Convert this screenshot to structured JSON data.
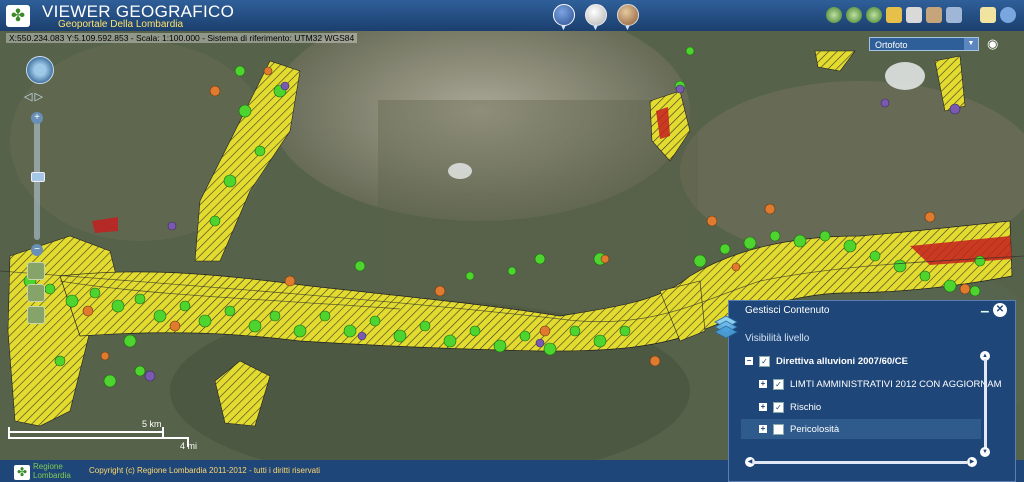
{
  "header": {
    "title": "VIEWER GEOGRAFICO",
    "subtitle": "Geoportale Della Lombardia"
  },
  "map": {
    "coordinates": "X:550.234.083 Y:5.109.592.853 - Scala: 1:100.000 - Sistema di riferimento: UTM32 WGS84",
    "basemap": "Ortofoto",
    "scale_km": "5 km",
    "scale_mi": "4 mi"
  },
  "panel": {
    "title": "Gestisci Contenuto",
    "subtitle": "Visibilità livello",
    "layers": [
      {
        "label": "Direttiva alluvioni 2007/60/CE",
        "checked": true
      },
      {
        "label": "LIMTI AMMINISTRATIVI 2012 CON AGGIORNAM",
        "checked": true
      },
      {
        "label": "Rischio",
        "checked": true
      },
      {
        "label": "Pericolosità",
        "checked": false
      }
    ]
  },
  "footer": {
    "brand_line1": "Regione",
    "brand_line2": "Lombardia",
    "copyright": "Copyright (c) Regione Lombardia 2011-2012 - tutti i diritti riservati"
  },
  "colors": {
    "header": "#1f4678",
    "flood_yellow": "#e8e43a",
    "risk_green": "#4ed42e",
    "risk_orange": "#e07a2e",
    "risk_red": "#c41e1e",
    "risk_purple": "#7a5ab0"
  }
}
